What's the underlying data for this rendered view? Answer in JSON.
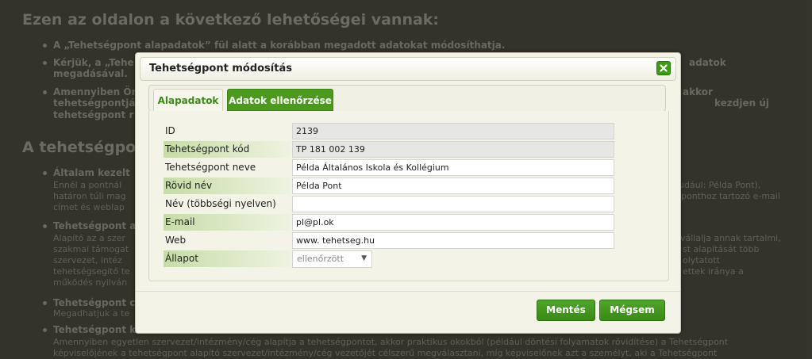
{
  "background": {
    "heading1": "Ezen az oldalon a következő lehetőségei vannak:",
    "bullet1": "A „Tehetségpont alapadatok” fül alatt a korábban megadott adatokat módosíthatja.",
    "bullet2_left": "Kérjük, a „Tehe",
    "bullet2_right": "adatok",
    "bullet2_line2": "megadásával.",
    "bullet3_left": "Amennyiben Ön",
    "bullet3_right": "akkor",
    "bullet3_line2_left": "tehetségpontjá",
    "bullet3_line2_right": "kezdjen új",
    "bullet3_line3": "tehetségpont r",
    "heading2": "A tehetségpont",
    "bullet4_title": "Általam kezelt",
    "bullet4_l1": "Ennél a pontnál",
    "bullet4_l1_right": "udául: Példa Pont),",
    "bullet4_l2": "határon túli mag",
    "bullet4_l2_right": "ponthoz tartozó e-mail",
    "bullet4_l3": "címet és weblap",
    "bullet5_title": "Tehetségpont a",
    "bullet5_l1": "Alapító az a szer",
    "bullet5_l1_right": "vállalja annak tartalmi,",
    "bullet5_l2": "szakmai támogat",
    "bullet5_l2_right": "st alapítását több",
    "bullet5_l3": "szervezet, intéz",
    "bullet5_l3_right": "olytatott",
    "bullet5_l4": "tehetségsegítő te",
    "bullet5_l4_right": "ettek iránya a",
    "bullet5_l5": "működés nyilván",
    "bullet6_title": "Tehetségpont c",
    "bullet6_l1": "Megadhatjuk a te",
    "bullet7_title": "Tehetségpont k",
    "bullet7_l1": "Amennyiben egyetlen szervezet/intézmény/cég alapítja a tehetségpontot, akkor praktikus okokból (például döntési folyamatok rövidítése) a Tehetségpont",
    "bullet7_l2": "képviselőjének a tehetségpont alapító szervezet/intézmény/cég vezetőjét célszerű megválasztani, míg képviselőnek azt a személyt, aki a Tehetségpont"
  },
  "modal": {
    "title": "Tehetségpont módosítás",
    "close_icon": "close-icon",
    "tabs": [
      {
        "label": "Alapadatok",
        "active": true
      },
      {
        "label": "Adatok ellenőrzése",
        "active": false
      }
    ],
    "fields": {
      "id": {
        "label": "ID",
        "value": "2139"
      },
      "kod": {
        "label": "Tehetségpont kód",
        "value": "TP 181 002 139"
      },
      "nev": {
        "label": "Tehetségpont neve",
        "value": "Példa Általános Iskola és Kollégium"
      },
      "rovid": {
        "label": "Rövid név",
        "value": "Példa Pont"
      },
      "tobbsegi": {
        "label": "Név (többségi nyelven)",
        "value": ""
      },
      "email": {
        "label": "E-mail",
        "value": "pl@pl.ok"
      },
      "web": {
        "label": "Web",
        "value": "www. tehetseg.hu"
      },
      "allapot": {
        "label": "Állapot",
        "value": "ellenőrzött"
      }
    },
    "buttons": {
      "save": "Mentés",
      "cancel": "Mégsem"
    }
  },
  "colors": {
    "accent_green": "#3d9a15",
    "highlight_label": "#c7dca8"
  }
}
